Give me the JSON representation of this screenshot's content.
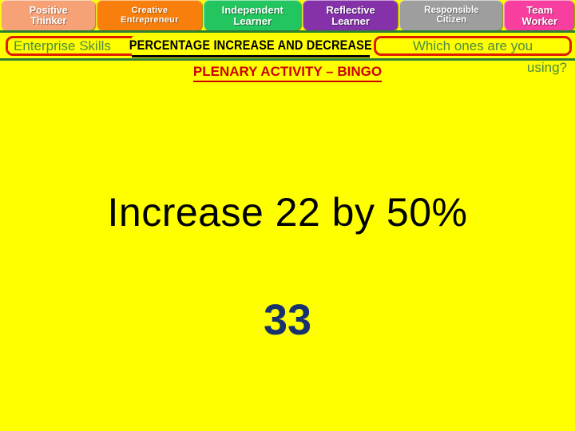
{
  "slide": {
    "background_color": "#FFFF00",
    "accent_red": "#E01B00",
    "accent_green": "#4C8C3F",
    "title_red": "#CC0000",
    "answer_blue": "#17326E"
  },
  "tabs": [
    {
      "line1": "Positive",
      "line2": "Thinker",
      "color": "#F6A276"
    },
    {
      "line1": "Creative",
      "line2": "Entrepreneur",
      "color": "#F97F0C"
    },
    {
      "line1": "Independent",
      "line2": "Learner",
      "color": "#22C55E"
    },
    {
      "line1": "Reflective",
      "line2": "Learner",
      "color": "#8431AA"
    },
    {
      "line1": "Responsible",
      "line2": "Citizen",
      "color": "#9E9E9E"
    },
    {
      "line1": "Team",
      "line2": "Worker",
      "color": "#F83FA0"
    }
  ],
  "header": {
    "enterprise_label": "Enterprise Skills",
    "banner_title": "PERCENTAGE INCREASE AND DECREASE",
    "which_line1": "Which ones are you",
    "which_line2": "using?",
    "plenary_title": "PLENARY ACTIVITY – BINGO"
  },
  "main": {
    "question": "Increase 22 by 50%",
    "answer": "33"
  }
}
